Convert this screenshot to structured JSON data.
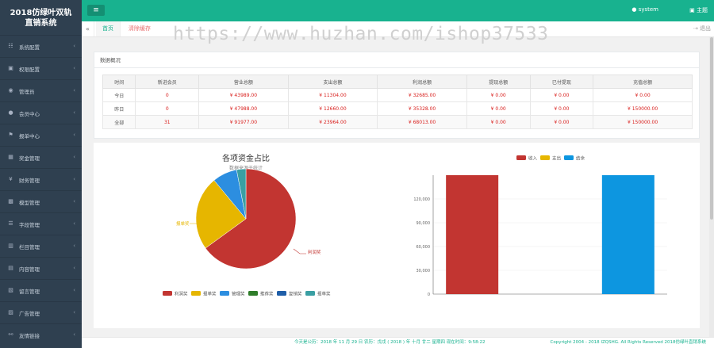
{
  "app": {
    "title_line1": "2018仿绿叶双轨",
    "title_line2": "直销系统"
  },
  "sidebar": {
    "items": [
      {
        "label": "系统配置",
        "icon": "settings-icon"
      },
      {
        "label": "权限配置",
        "icon": "lock-icon"
      },
      {
        "label": "管理员",
        "icon": "user-circle-icon"
      },
      {
        "label": "会员中心",
        "icon": "user-icon"
      },
      {
        "label": "报单中心",
        "icon": "flag-icon"
      },
      {
        "label": "奖金管理",
        "icon": "grid-icon"
      },
      {
        "label": "财务管理",
        "icon": "yen-icon"
      },
      {
        "label": "模型管理",
        "icon": "cube-icon"
      },
      {
        "label": "字段管理",
        "icon": "list-icon"
      },
      {
        "label": "栏目管理",
        "icon": "columns-icon"
      },
      {
        "label": "内容管理",
        "icon": "doc-icon"
      },
      {
        "label": "留言管理",
        "icon": "message-icon"
      },
      {
        "label": "广告管理",
        "icon": "image-icon"
      },
      {
        "label": "友情链接",
        "icon": "link-icon"
      }
    ]
  },
  "topbar": {
    "menu_icon": "≡",
    "user": "system",
    "home": "主题"
  },
  "tabs": {
    "home": "首页",
    "clear": "清除缓存",
    "exit": "退出"
  },
  "watermark": "https://www.huzhan.com/ishop37533",
  "overview": {
    "title": "数据概况",
    "headers": [
      "时间",
      "新进会员",
      "营业总额",
      "支出总额",
      "利润总额",
      "提现总额",
      "已付提现",
      "充值总额"
    ],
    "rows": [
      [
        "今日",
        "0",
        "¥ 43989.00",
        "¥ 11304.00",
        "¥ 32685.00",
        "¥ 0.00",
        "¥ 0.00",
        "¥ 0.00"
      ],
      [
        "昨日",
        "0",
        "¥ 47988.00",
        "¥ 12660.00",
        "¥ 35328.00",
        "¥ 0.00",
        "¥ 0.00",
        "¥ 150000.00"
      ],
      [
        "全部",
        "31",
        "¥ 91977.00",
        "¥ 23964.00",
        "¥ 68013.00",
        "¥ 0.00",
        "¥ 0.00",
        "¥ 150000.00"
      ]
    ]
  },
  "footer": {
    "date": "今天是公历：2018 年 11 月 29 日    农历：戊戌 ( 2018 ) 年 十月 廿二    星期四    现在时间：9:58:22",
    "copyright": "Copyright 2004 - 2018 IZQSHG. All Rights Reserved    2018仿绿叶直销系统"
  },
  "chart_data": [
    {
      "type": "pie",
      "title": "各项资金占比",
      "subtitle": "数据来源于统计",
      "categories": [
        "利润奖",
        "报单奖",
        "管理奖",
        "推荐奖",
        "复销奖",
        "报单奖"
      ],
      "values": [
        65,
        24,
        8,
        0,
        0,
        3
      ],
      "colors": [
        "#c23531",
        "#e6b600",
        "#2c8ee0",
        "#2f7d2a",
        "#1f5ea8",
        "#3a9fa3"
      ],
      "slice_labels": [
        "利润奖",
        "报单奖"
      ]
    },
    {
      "type": "bar",
      "categories": [
        "收入",
        "支出",
        "结余"
      ],
      "series": [
        {
          "name": "收入",
          "values": [
            150000
          ]
        },
        {
          "name": "支出",
          "values": [
            0
          ]
        },
        {
          "name": "结余",
          "values": [
            150000
          ]
        }
      ],
      "colors": [
        "#c23531",
        "#e6b600",
        "#0d96e0"
      ],
      "ylim": [
        0,
        150000
      ],
      "yticks": [
        "0",
        "30,000",
        "60,000",
        "90,000",
        "120,000"
      ],
      "legend_position": "top"
    }
  ]
}
